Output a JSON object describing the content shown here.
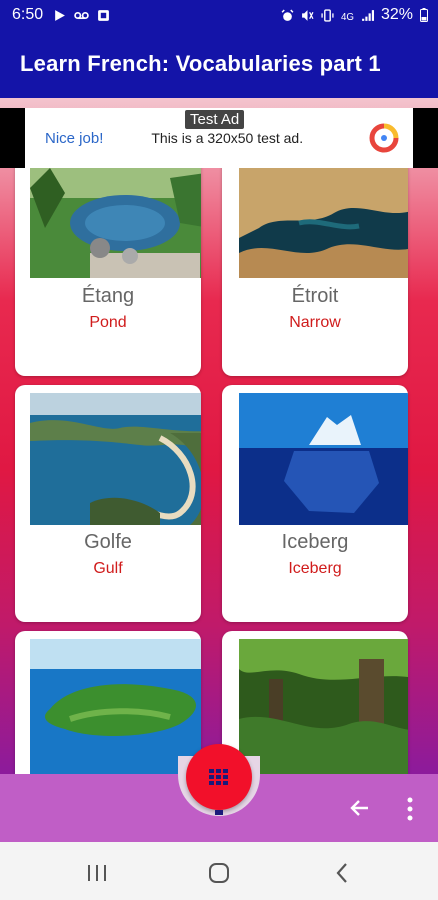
{
  "status_bar": {
    "time": "6:50",
    "battery": "32%",
    "icons": [
      "play-icon",
      "voicemail-icon",
      "app-icon",
      "alarm-icon",
      "mute-icon",
      "vibrate-icon",
      "4g-icon",
      "signal-icon",
      "battery-icon"
    ]
  },
  "app_bar": {
    "title": "Learn French: Vocabularies part 1"
  },
  "ad": {
    "label": "Test Ad",
    "nice": "Nice job!",
    "text": "This is a 320x50 test ad."
  },
  "cards": [
    {
      "word": "Étang",
      "translation": "Pond"
    },
    {
      "word": "Étroit",
      "translation": "Narrow"
    },
    {
      "word": "Golfe",
      "translation": "Gulf"
    },
    {
      "word": "Iceberg",
      "translation": "Iceberg"
    },
    {
      "word": "",
      "translation": ""
    },
    {
      "word": "",
      "translation": ""
    }
  ],
  "bottom_bar": {
    "fab_icon": "grid-icon",
    "back_icon": "arrow-left-icon",
    "menu_icon": "more-vert-icon"
  },
  "colors": {
    "app_bar": "#1414a8",
    "accent_red": "#f2102a",
    "bottom_bar": "#c05ec6",
    "translation": "#d01c1c"
  }
}
